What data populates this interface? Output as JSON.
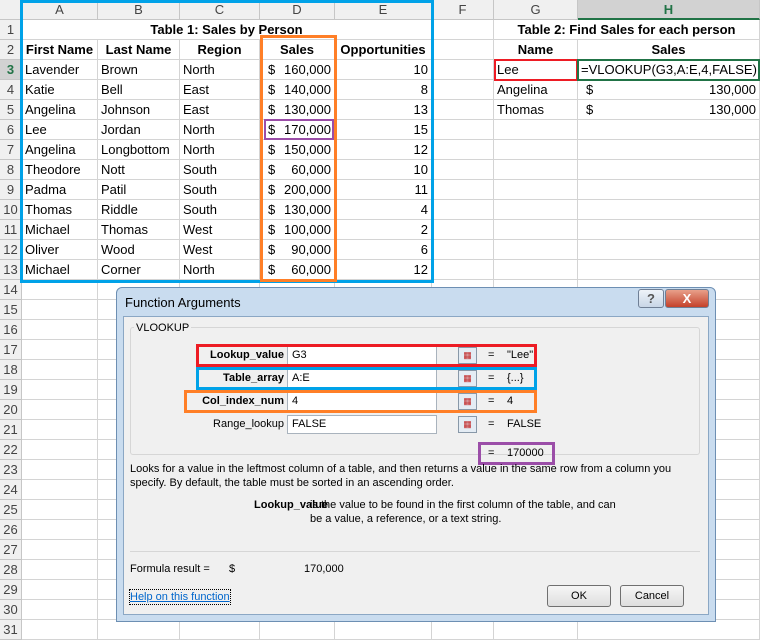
{
  "columns": [
    "A",
    "B",
    "C",
    "D",
    "E",
    "F",
    "G",
    "H"
  ],
  "selected_cell": "H3",
  "table1": {
    "title": "Table 1: Sales by Person",
    "headers": [
      "First Name",
      "Last Name",
      "Region",
      "Sales",
      "Opportunities"
    ],
    "rows": [
      [
        "Lavender",
        "Brown",
        "North",
        "160,000",
        "10"
      ],
      [
        "Katie",
        "Bell",
        "East",
        "140,000",
        "8"
      ],
      [
        "Angelina",
        "Johnson",
        "East",
        "130,000",
        "13"
      ],
      [
        "Lee",
        "Jordan",
        "North",
        "170,000",
        "15"
      ],
      [
        "Angelina",
        "Longbottom",
        "North",
        "150,000",
        "12"
      ],
      [
        "Theodore",
        "Nott",
        "South",
        "60,000",
        "10"
      ],
      [
        "Padma",
        "Patil",
        "South",
        "200,000",
        "11"
      ],
      [
        "Thomas",
        "Riddle",
        "South",
        "130,000",
        "4"
      ],
      [
        "Michael",
        "Thomas",
        "West",
        "100,000",
        "2"
      ],
      [
        "Oliver",
        "Wood",
        "West",
        "90,000",
        "6"
      ],
      [
        "Michael",
        "Corner",
        "North",
        "60,000",
        "12"
      ]
    ],
    "currency": "$"
  },
  "table2": {
    "title": "Table 2: Find Sales for each person",
    "headers": [
      "Name",
      "Sales"
    ],
    "rows": [
      [
        "Lee",
        "=VLOOKUP(G3,A:E,4,FALSE)"
      ],
      [
        "Angelina",
        "130,000"
      ],
      [
        "Thomas",
        "130,000"
      ]
    ]
  },
  "dialog": {
    "title": "Function Arguments",
    "help_btn": "?",
    "close_btn": "X",
    "function_name": "VLOOKUP",
    "args": [
      {
        "label": "Lookup_value",
        "value": "G3",
        "result": "\"Lee\""
      },
      {
        "label": "Table_array",
        "value": "A:E",
        "result": "{...}"
      },
      {
        "label": "Col_index_num",
        "value": "4",
        "result": "4"
      },
      {
        "label": "Range_lookup",
        "value": "FALSE",
        "result": "FALSE"
      }
    ],
    "eq": "=",
    "overall_result": "170000",
    "description": "Looks for a value in the leftmost column of a table, and then returns a value in the same row from a column you specify. By default, the table must be sorted in an ascending order.",
    "arg_help_name": "Lookup_value",
    "arg_help_text": "is the value to be found in the first column of the table, and can be a value, a reference, or a text string.",
    "formula_result_label": "Formula result =",
    "formula_result_currency": "$",
    "formula_result_value": "170,000",
    "help_link": "Help on this function",
    "ok": "OK",
    "cancel": "Cancel"
  },
  "colors": {
    "blue": "#00a2e8",
    "orange": "#ff7f27",
    "purple": "#9b4ea8",
    "red": "#ed1c24",
    "green": "#217346"
  }
}
